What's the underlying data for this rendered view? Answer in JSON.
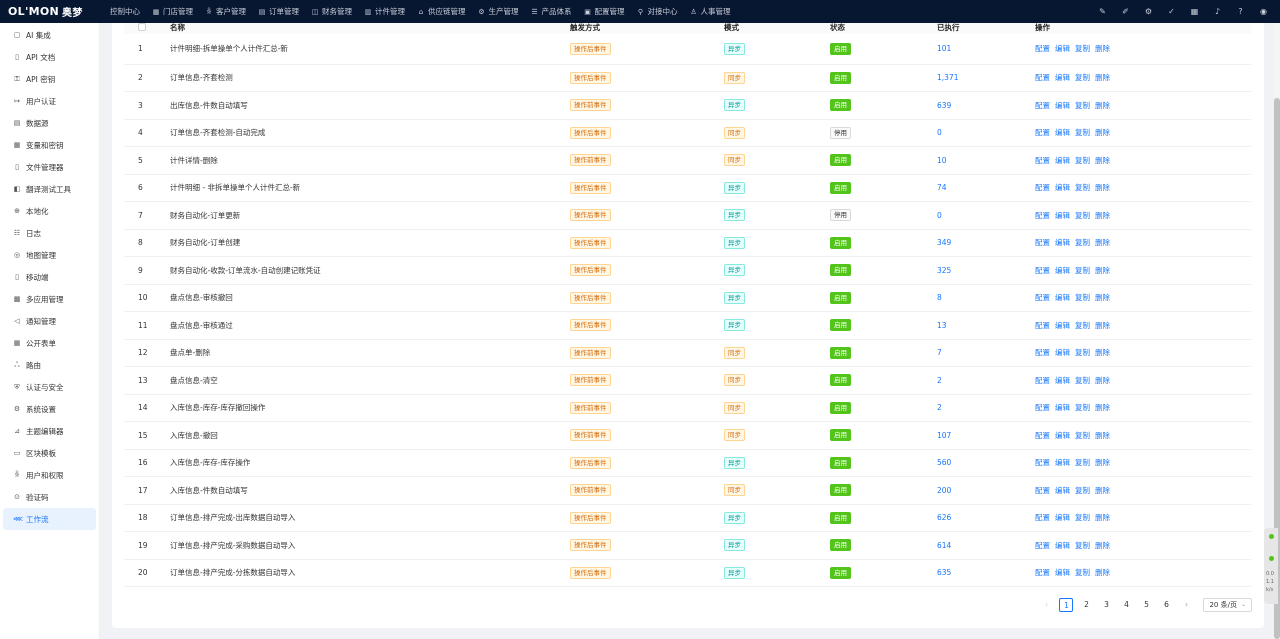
{
  "brand": {
    "logo": "OL'MON",
    "logo_cn": "奥梦"
  },
  "nav": [
    {
      "label": "控制中心",
      "icon": ""
    },
    {
      "label": "门店管理",
      "icon": "store-icon"
    },
    {
      "label": "客户管理",
      "icon": "users-icon"
    },
    {
      "label": "订单管理",
      "icon": "order-icon"
    },
    {
      "label": "财务管理",
      "icon": "finance-icon"
    },
    {
      "label": "计件管理",
      "icon": "piecework-icon"
    },
    {
      "label": "供应链管理",
      "icon": "supply-icon"
    },
    {
      "label": "生产管理",
      "icon": "gear-icon"
    },
    {
      "label": "产品体系",
      "icon": "product-icon"
    },
    {
      "label": "配置管理",
      "icon": "config-icon"
    },
    {
      "label": "对接中心",
      "icon": "link-icon"
    },
    {
      "label": "人事管理",
      "icon": "person-icon"
    }
  ],
  "top_icons": [
    "pen-icon",
    "brush-icon",
    "settings-icon",
    "check-circle-icon",
    "grid-icon",
    "bell-icon",
    "help-icon",
    "user-icon"
  ],
  "sidebar": [
    {
      "label": "AI 集成",
      "icon": "ai-icon"
    },
    {
      "label": "API 文档",
      "icon": "doc-icon"
    },
    {
      "label": "API 密钥",
      "icon": "key-icon"
    },
    {
      "label": "用户认证",
      "icon": "login-icon"
    },
    {
      "label": "数据源",
      "icon": "database-icon"
    },
    {
      "label": "变量和密钥",
      "icon": "variable-icon"
    },
    {
      "label": "文件管理器",
      "icon": "file-icon"
    },
    {
      "label": "翻译测试工具",
      "icon": "translate-icon"
    },
    {
      "label": "本地化",
      "icon": "globe-icon"
    },
    {
      "label": "日志",
      "icon": "log-icon"
    },
    {
      "label": "地图管理",
      "icon": "map-pin-icon"
    },
    {
      "label": "移动端",
      "icon": "mobile-icon"
    },
    {
      "label": "多应用管理",
      "icon": "apps-icon"
    },
    {
      "label": "通知管理",
      "icon": "notification-icon"
    },
    {
      "label": "公开表单",
      "icon": "form-icon"
    },
    {
      "label": "路由",
      "icon": "route-icon"
    },
    {
      "label": "认证与安全",
      "icon": "shield-icon"
    },
    {
      "label": "系统设置",
      "icon": "gear-icon"
    },
    {
      "label": "主题编辑器",
      "icon": "theme-icon"
    },
    {
      "label": "区块模板",
      "icon": "block-icon"
    },
    {
      "label": "用户和权限",
      "icon": "users-icon"
    },
    {
      "label": "验证码",
      "icon": "captcha-icon"
    },
    {
      "label": "工作流",
      "icon": "workflow-icon",
      "active": true
    }
  ],
  "table": {
    "headers": {
      "name": "名称",
      "trigger": "触发方式",
      "mode": "模式",
      "status": "状态",
      "executed": "已执行",
      "ops": "操作"
    },
    "ops": [
      "配置",
      "编辑",
      "复制",
      "删除"
    ],
    "rows": [
      {
        "idx": "1",
        "name": "计件明细-拆单操单个人计件汇总-新",
        "trigger": "操作后事件",
        "mode": "异步",
        "status": "启用",
        "executed": "101"
      },
      {
        "idx": "2",
        "name": "订单信息-齐套检测",
        "trigger": "操作后事件",
        "mode": "同步",
        "status": "启用",
        "executed": "1,371"
      },
      {
        "idx": "3",
        "name": "出库信息-件数自动填写",
        "trigger": "操作前事件",
        "mode": "异步",
        "status": "启用",
        "executed": "639"
      },
      {
        "idx": "4",
        "name": "订单信息-齐套检测-自动完成",
        "trigger": "操作后事件",
        "mode": "同步",
        "status": "停用",
        "executed": "0"
      },
      {
        "idx": "5",
        "name": "计件详情-删除",
        "trigger": "操作前事件",
        "mode": "同步",
        "status": "启用",
        "executed": "10"
      },
      {
        "idx": "6",
        "name": "计件明细 - 非拆单操单个人计件汇总-新",
        "trigger": "操作后事件",
        "mode": "异步",
        "status": "启用",
        "executed": "74"
      },
      {
        "idx": "7",
        "name": "财务自动化-订单更新",
        "trigger": "操作后事件",
        "mode": "异步",
        "status": "停用",
        "executed": "0"
      },
      {
        "idx": "8",
        "name": "财务自动化-订单创建",
        "trigger": "操作后事件",
        "mode": "异步",
        "status": "启用",
        "executed": "349"
      },
      {
        "idx": "9",
        "name": "财务自动化-收款-订单流水-自动创建记账凭证",
        "trigger": "操作后事件",
        "mode": "异步",
        "status": "启用",
        "executed": "325"
      },
      {
        "idx": "10",
        "name": "盘点信息-审核撤回",
        "trigger": "操作后事件",
        "mode": "异步",
        "status": "启用",
        "executed": "8"
      },
      {
        "idx": "11",
        "name": "盘点信息-审核通过",
        "trigger": "操作后事件",
        "mode": "异步",
        "status": "启用",
        "executed": "13"
      },
      {
        "idx": "12",
        "name": "盘点单-删除",
        "trigger": "操作前事件",
        "mode": "同步",
        "status": "启用",
        "executed": "7"
      },
      {
        "idx": "13",
        "name": "盘点信息-清空",
        "trigger": "操作前事件",
        "mode": "同步",
        "status": "启用",
        "executed": "2"
      },
      {
        "idx": "14",
        "name": "入库信息-库存-库存撤回操作",
        "trigger": "操作前事件",
        "mode": "同步",
        "status": "启用",
        "executed": "2"
      },
      {
        "idx": "15",
        "name": "入库信息-撤回",
        "trigger": "操作前事件",
        "mode": "同步",
        "status": "启用",
        "executed": "107"
      },
      {
        "idx": "16",
        "name": "入库信息-库存-库存操作",
        "trigger": "操作后事件",
        "mode": "异步",
        "status": "启用",
        "executed": "560"
      },
      {
        "idx": "17",
        "name": "入库信息-件数自动填写",
        "trigger": "操作前事件",
        "mode": "同步",
        "status": "启用",
        "executed": "200"
      },
      {
        "idx": "18",
        "name": "订单信息-排产完成-出库数据自动导入",
        "trigger": "操作后事件",
        "mode": "异步",
        "status": "启用",
        "executed": "626"
      },
      {
        "idx": "19",
        "name": "订单信息-排产完成-采购数据自动导入",
        "trigger": "操作后事件",
        "mode": "异步",
        "status": "启用",
        "executed": "614"
      },
      {
        "idx": "20",
        "name": "订单信息-排产完成-分拣数据自动导入",
        "trigger": "操作后事件",
        "mode": "异步",
        "status": "启用",
        "executed": "635"
      }
    ]
  },
  "pagination": {
    "pages": [
      "1",
      "2",
      "3",
      "4",
      "5",
      "6"
    ],
    "current": "1",
    "page_size": "20 条/页"
  },
  "floater": {
    "line1": "0.0",
    "line2": "1.1",
    "line3": "k/s"
  }
}
